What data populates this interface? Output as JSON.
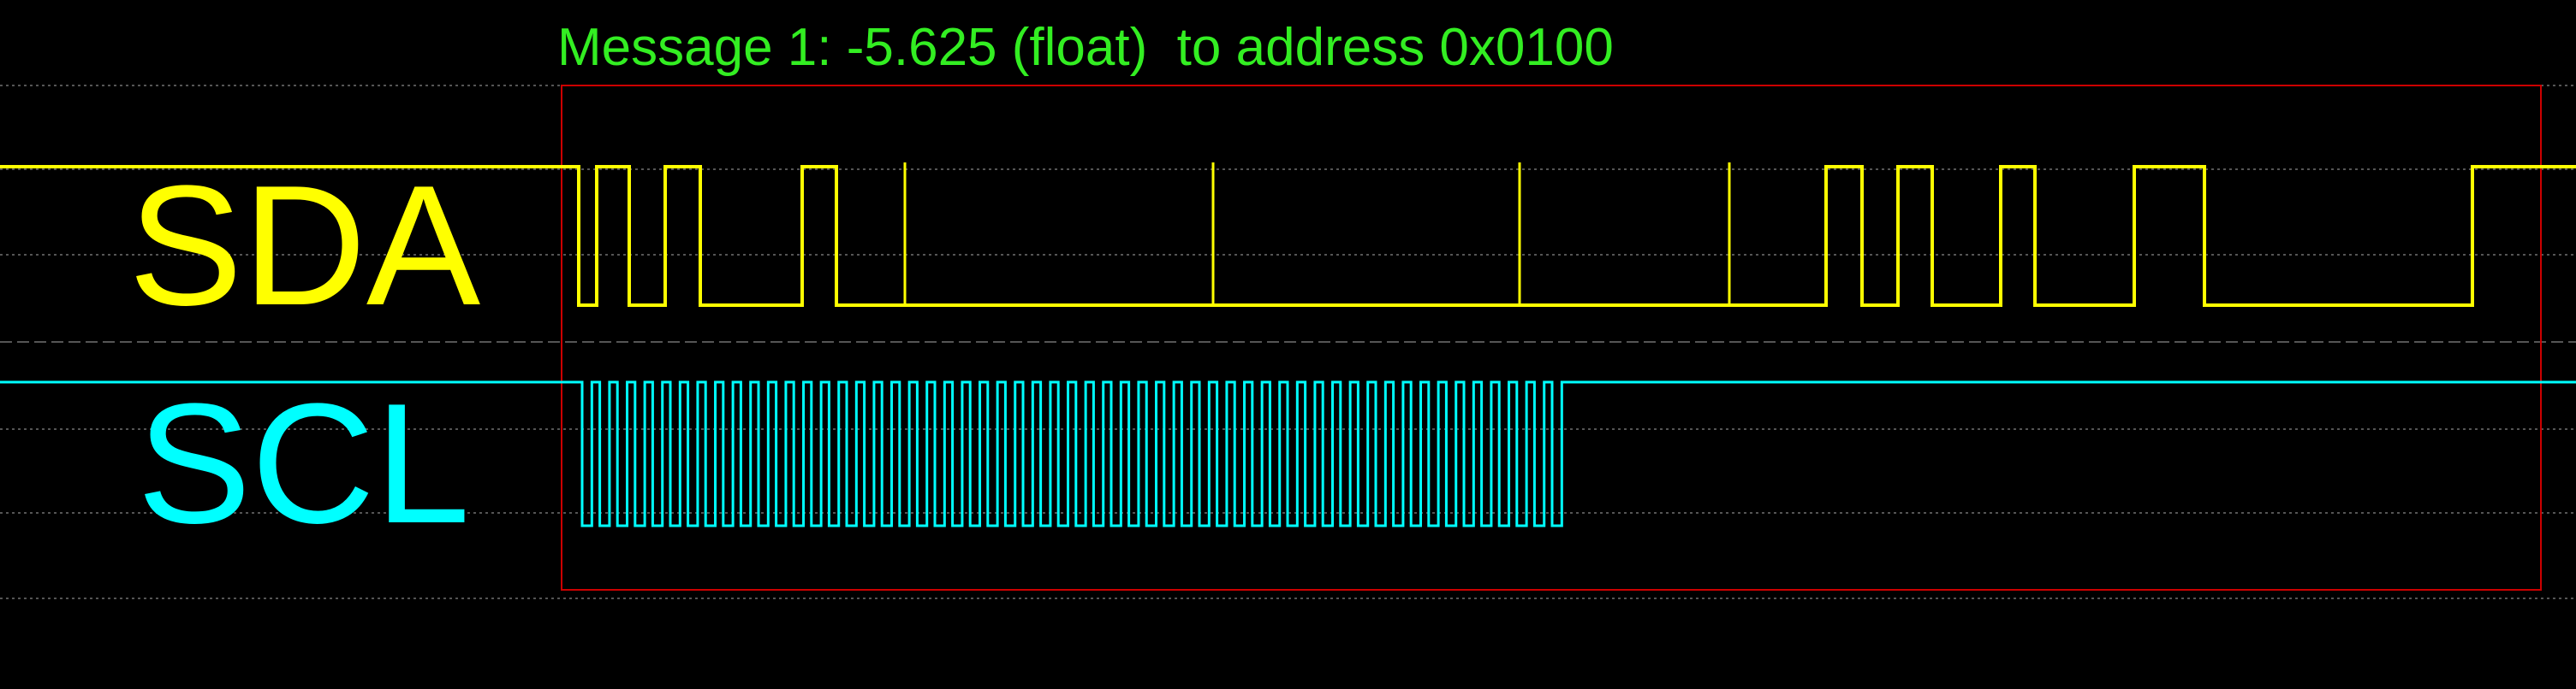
{
  "title": "Message 1: -5.625 (float)  to address 0x0100",
  "colors": {
    "background": "#000000",
    "title": "#33ee22",
    "sda": "#ffff00",
    "scl": "#00ffff",
    "grid": "#555555",
    "frame": "#cc0000"
  },
  "chart_data": {
    "type": "line",
    "title": "Message 1: -5.625 (float)  to address 0x0100",
    "xlabel": "",
    "ylabel": "",
    "grid": true,
    "frame": true,
    "series": [
      {
        "name": "SDA",
        "values": [
          [
            0,
            1
          ],
          [
            676,
            1
          ],
          [
            676,
            0
          ],
          [
            697,
            0
          ],
          [
            697,
            1
          ],
          [
            735,
            1
          ],
          [
            735,
            0
          ],
          [
            777,
            0
          ],
          [
            777,
            1
          ],
          [
            818,
            1
          ],
          [
            818,
            0
          ],
          [
            937,
            0
          ],
          [
            937,
            1
          ],
          [
            977,
            1
          ],
          [
            977,
            0
          ],
          [
            2133,
            0
          ],
          [
            2133,
            1
          ],
          [
            2175,
            1
          ],
          [
            2175,
            0
          ],
          [
            2217,
            0
          ],
          [
            2217,
            1
          ],
          [
            2257,
            1
          ],
          [
            2257,
            0
          ],
          [
            2337,
            0
          ],
          [
            2337,
            1
          ],
          [
            2377,
            1
          ],
          [
            2377,
            0
          ],
          [
            2493,
            0
          ],
          [
            2493,
            1
          ],
          [
            2575,
            1
          ],
          [
            2575,
            0
          ],
          [
            2888,
            0
          ],
          [
            2888,
            1
          ],
          [
            3009,
            1
          ]
        ]
      },
      {
        "name": "SCL",
        "start": 680,
        "clocks": 56,
        "period": 20.6,
        "idle_before": 1,
        "idle_after": 1
      }
    ]
  },
  "labels": {
    "sda": "SDA",
    "scl": "SCL"
  }
}
